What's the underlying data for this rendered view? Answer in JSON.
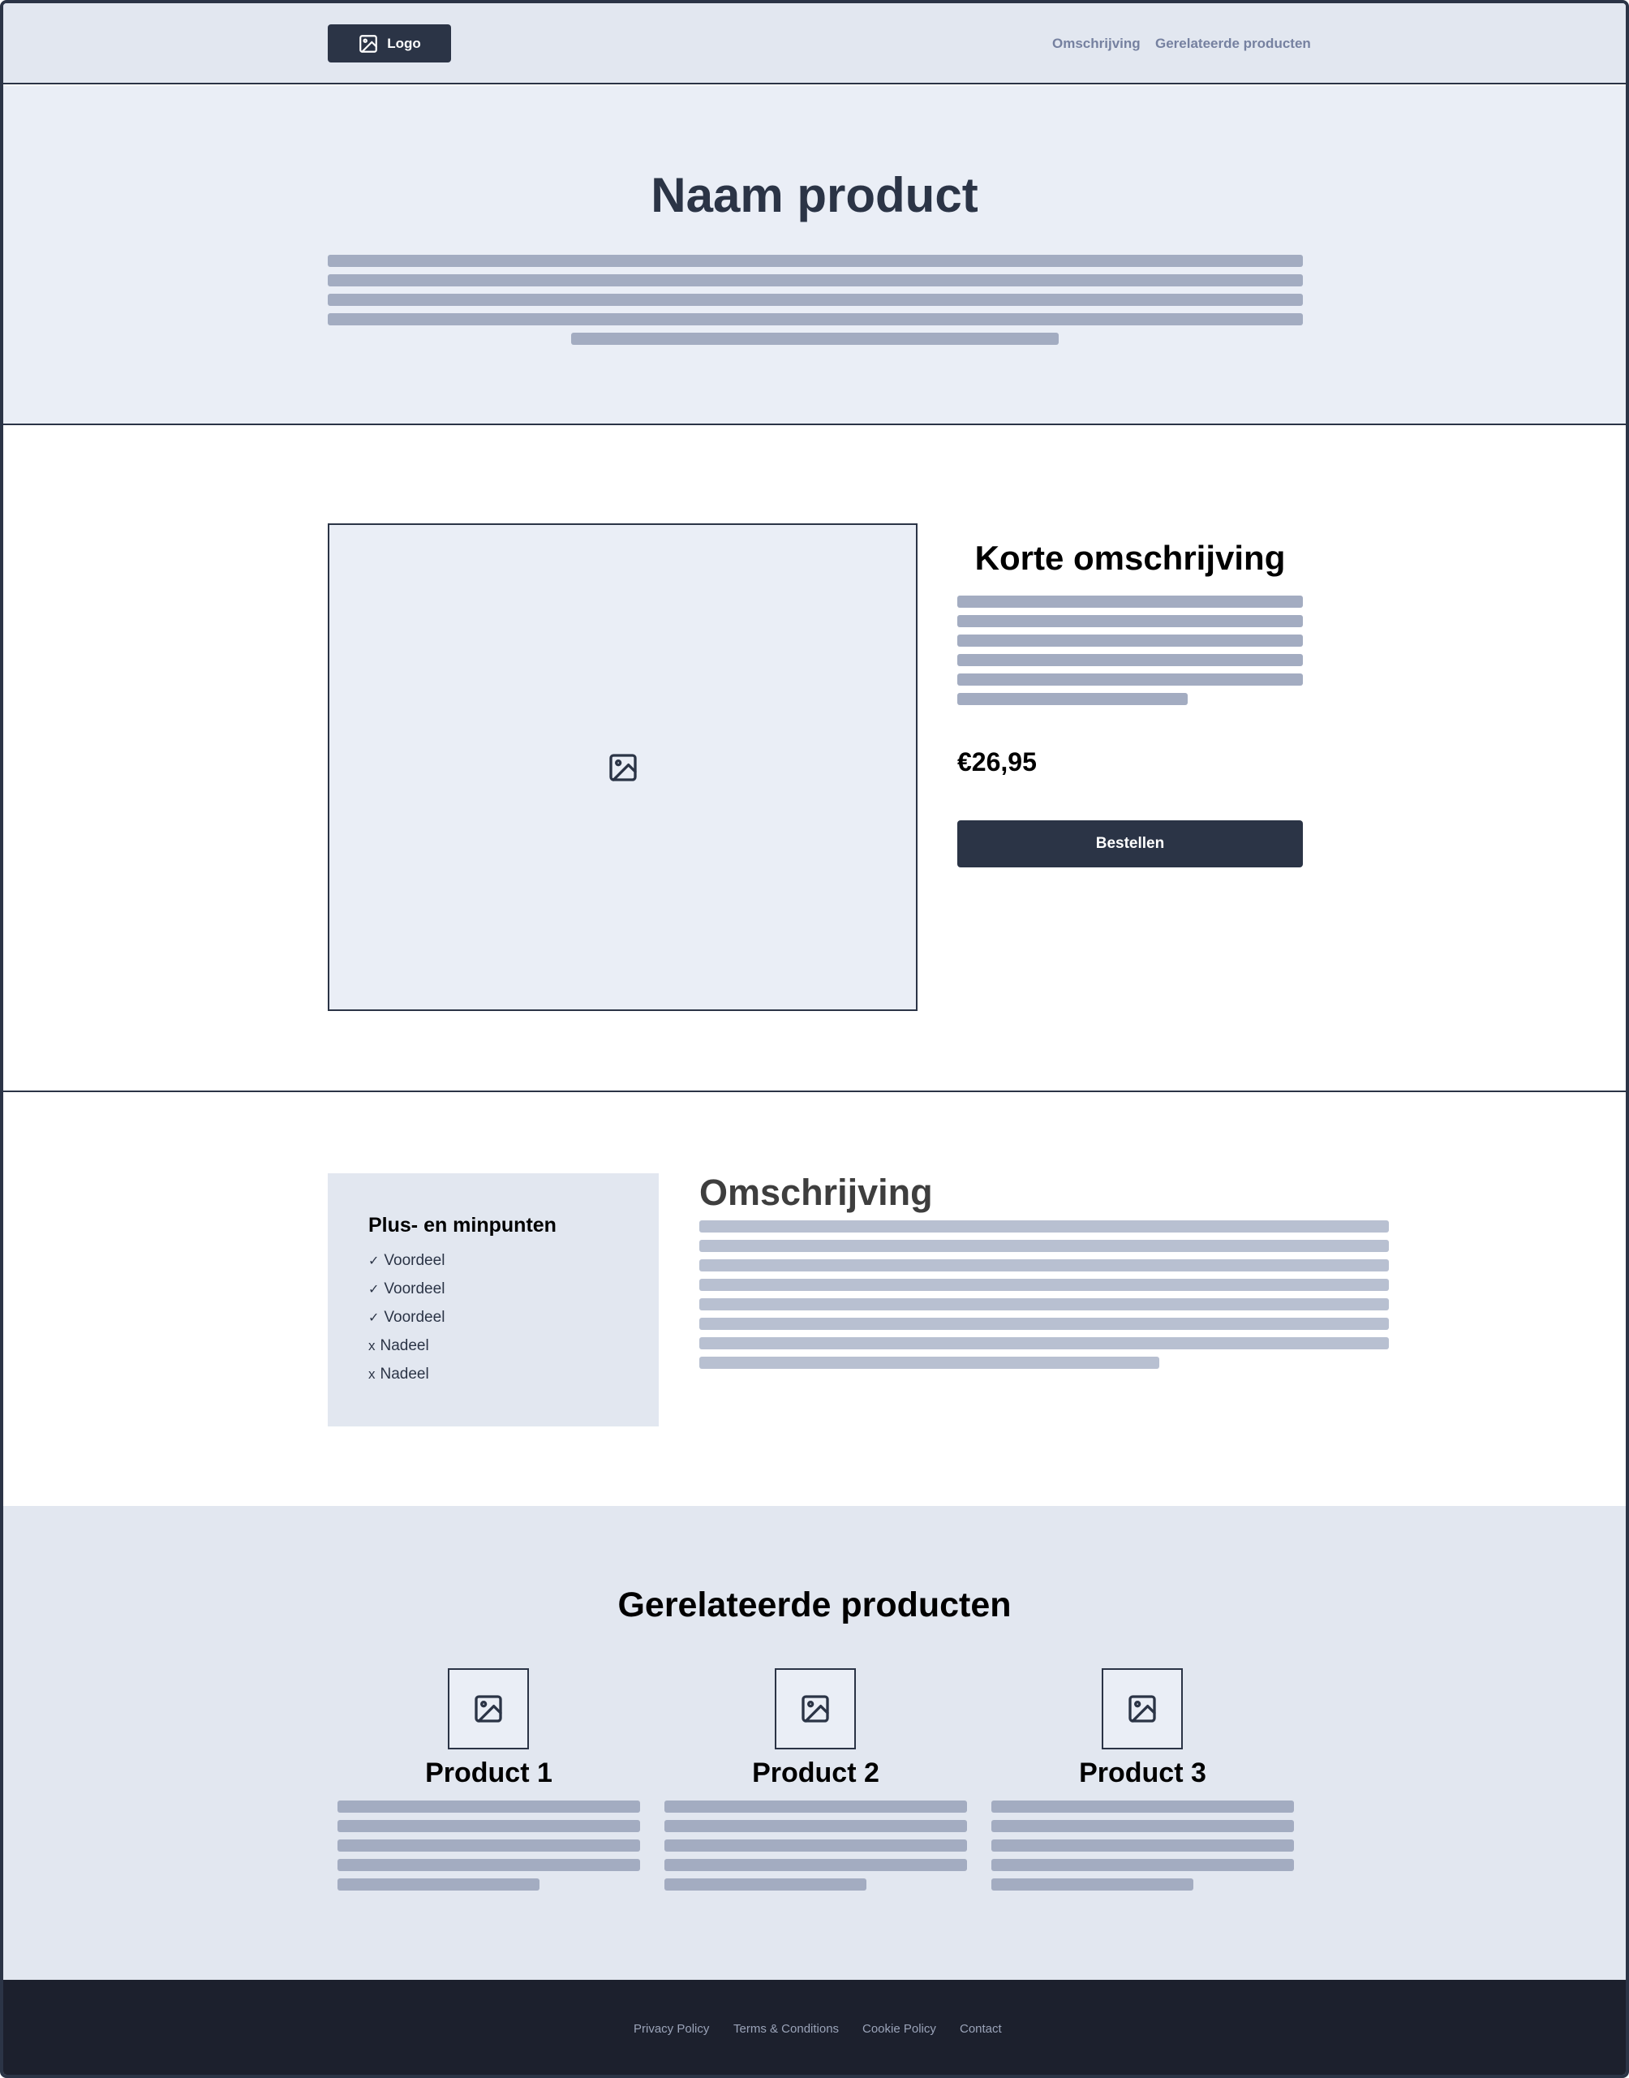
{
  "header": {
    "logo_label": "Logo",
    "nav": [
      "Omschrijving",
      "Gerelateerde producten"
    ]
  },
  "hero": {
    "title": "Naam product"
  },
  "product": {
    "short_title": "Korte omschrijving",
    "price": "€26,95",
    "order_label": "Bestellen"
  },
  "pros_cons": {
    "title": "Plus- en minpunten",
    "items": [
      {
        "mark": "✓",
        "label": "Voordeel",
        "kind": "pro"
      },
      {
        "mark": "✓",
        "label": "Voordeel",
        "kind": "pro"
      },
      {
        "mark": "✓",
        "label": "Voordeel",
        "kind": "pro"
      },
      {
        "mark": "x",
        "label": "Nadeel",
        "kind": "con"
      },
      {
        "mark": "x",
        "label": "Nadeel",
        "kind": "con"
      }
    ]
  },
  "description": {
    "title": "Omschrijving"
  },
  "related": {
    "title": "Gerelateerde producten",
    "products": [
      {
        "name": "Product 1"
      },
      {
        "name": "Product 2"
      },
      {
        "name": "Product 3"
      }
    ]
  },
  "footer": {
    "links": [
      "Privacy Policy",
      "Terms & Conditions",
      "Cookie Policy",
      "Contact"
    ]
  },
  "colors": {
    "primary": "#2b3446",
    "placeholder_line": "#a3acc1",
    "section_bg": "#e2e7f0",
    "hero_bg": "#eaeef6",
    "footer_bg": "#1c202d"
  },
  "icons": {
    "image_placeholder": "image-icon"
  }
}
